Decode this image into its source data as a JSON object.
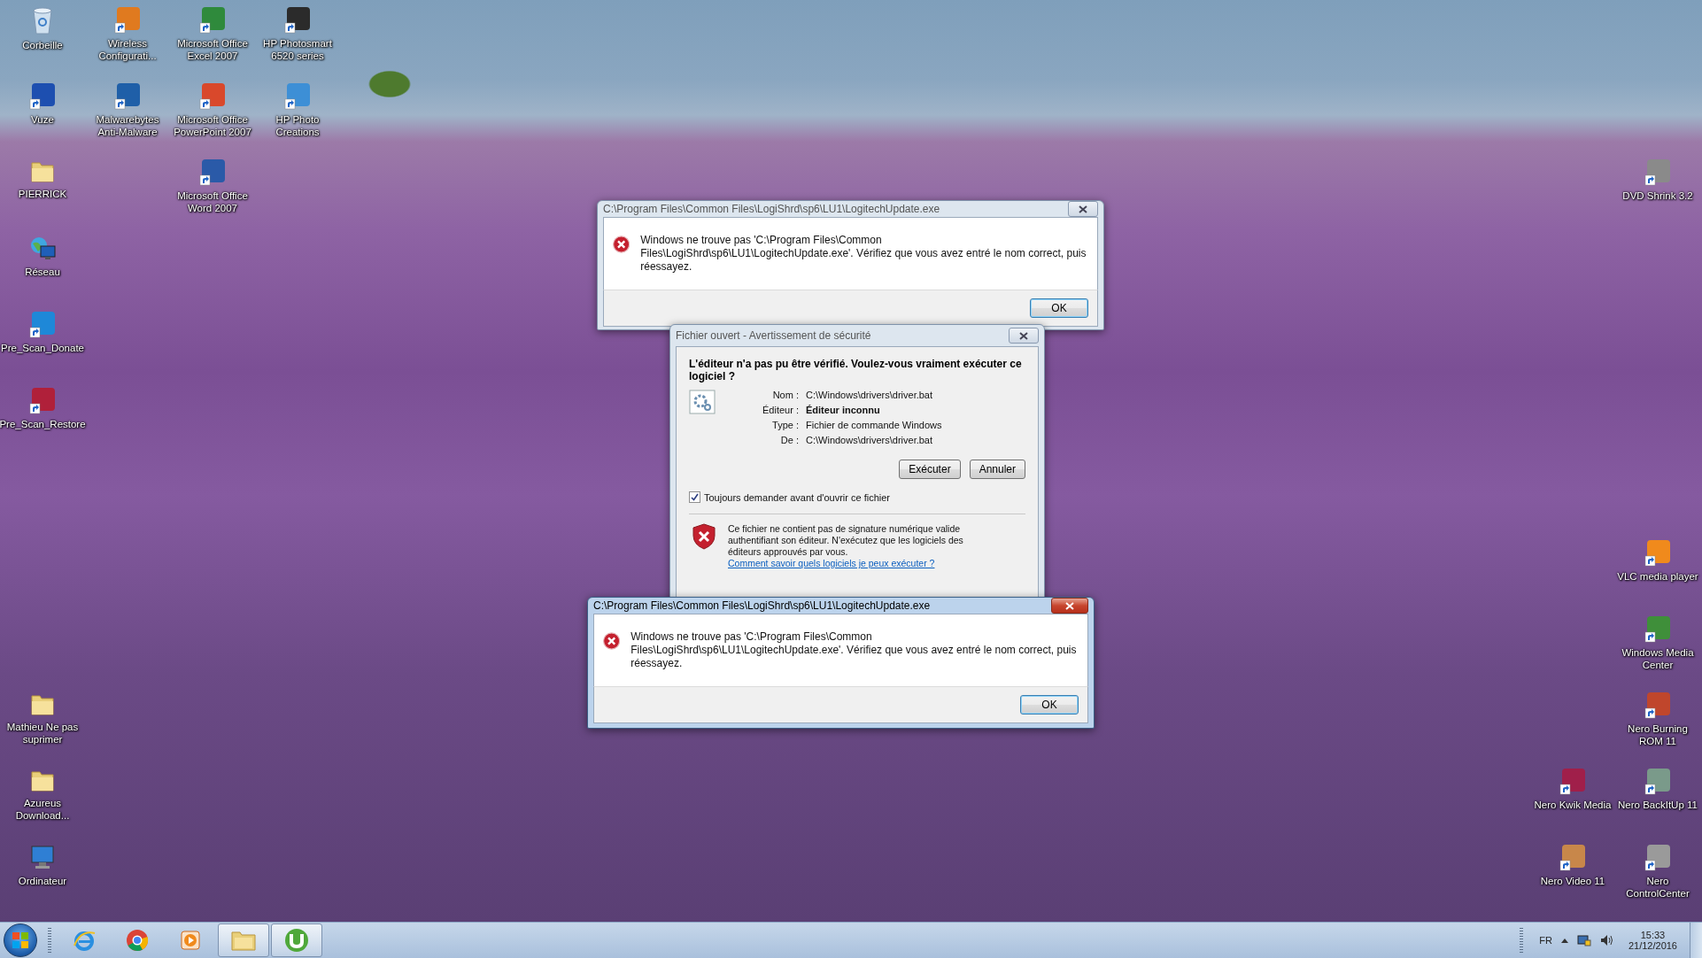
{
  "desktop_icons": [
    {
      "kind": "bin",
      "label": "Corbeille"
    },
    {
      "kind": "shortcut",
      "label": "Wireless Configurati...",
      "color": "#e07a1f"
    },
    {
      "kind": "shortcut",
      "label": "Microsoft Office Excel 2007",
      "color": "#2f8a3c"
    },
    {
      "kind": "shortcut",
      "label": "HP Photosmart 6520 series",
      "color": "#2b2b2b"
    },
    {
      "kind": "shortcut",
      "label": "Vuze",
      "color": "#1d4fb0"
    },
    {
      "kind": "shortcut",
      "label": "Malwarebytes Anti-Malware",
      "color": "#1f5fa8"
    },
    {
      "kind": "shortcut",
      "label": "Microsoft Office PowerPoint 2007",
      "color": "#d9482b"
    },
    {
      "kind": "shortcut",
      "label": "HP Photo Creations",
      "color": "#3d8fd6"
    },
    {
      "kind": "folder",
      "label": "PIERRICK"
    },
    {
      "kind": "shortcut",
      "label": "Microsoft Office Word 2007",
      "color": "#2a5aa8"
    },
    {
      "kind": "network",
      "label": "Réseau"
    },
    {
      "kind": "shortcut",
      "label": "Pre_Scan_Donate",
      "color": "#1e88d8"
    },
    {
      "kind": "shortcut",
      "label": "Pre_Scan_Restore",
      "color": "#b0203a"
    },
    {
      "kind": "folder",
      "label": "Mathieu Ne pas suprimer"
    },
    {
      "kind": "folder",
      "label": "Azureus Download..."
    },
    {
      "kind": "computer",
      "label": "Ordinateur"
    },
    {
      "kind": "shortcut",
      "label": "DVD Shrink 3.2",
      "color": "#8a8a8a"
    },
    {
      "kind": "shortcut",
      "label": "VLC media player",
      "color": "#f08a1c"
    },
    {
      "kind": "shortcut",
      "label": "Windows Media Center",
      "color": "#3f8f3a"
    },
    {
      "kind": "shortcut",
      "label": "Nero Burning ROM 11",
      "color": "#c0462c"
    },
    {
      "kind": "shortcut",
      "label": "Nero Kwik Media",
      "color": "#a01f4a"
    },
    {
      "kind": "shortcut",
      "label": "Nero BackItUp 11",
      "color": "#7a9a8a"
    },
    {
      "kind": "shortcut",
      "label": "Nero Video 11",
      "color": "#c8874a"
    },
    {
      "kind": "shortcut",
      "label": "Nero ControlCenter",
      "color": "#9a9a9a"
    }
  ],
  "windows": [
    {
      "kind": "error",
      "active": false,
      "title": "C:\\Program Files\\Common Files\\LogiShrd\\sp6\\LU1\\LogitechUpdate.exe",
      "message": "Windows ne trouve pas 'C:\\Program Files\\Common Files\\LogiShrd\\sp6\\LU1\\LogitechUpdate.exe'. Vérifiez que vous avez entré le nom correct, puis réessayez.",
      "ok": "OK"
    },
    {
      "kind": "security",
      "active": false,
      "title": "Fichier ouvert - Avertissement de sécurité",
      "heading": "L'éditeur n'a pas pu être vérifié. Voulez-vous vraiment exécuter ce logiciel ?",
      "fields": [
        {
          "label": "Nom :",
          "value": "C:\\Windows\\drivers\\driver.bat",
          "bold": false
        },
        {
          "label": "Éditeur :",
          "value": "Éditeur inconnu",
          "bold": true
        },
        {
          "label": "Type :",
          "value": "Fichier de commande Windows",
          "bold": false
        },
        {
          "label": "De :",
          "value": "C:\\Windows\\drivers\\driver.bat",
          "bold": false
        }
      ],
      "buttons": [
        "Exécuter",
        "Annuler"
      ],
      "checkbox": {
        "label": "Toujours demander avant d'ouvrir ce fichier",
        "checked": true
      },
      "footer": {
        "text": "Ce fichier ne contient pas de signature numérique valide authentifiant son éditeur. N'exécutez que les logiciels des éditeurs approuvés par vous.",
        "link": "Comment savoir quels logiciels je peux exécuter ?"
      }
    },
    {
      "kind": "error",
      "active": true,
      "title": "C:\\Program Files\\Common Files\\LogiShrd\\sp6\\LU1\\LogitechUpdate.exe",
      "message": "Windows ne trouve pas 'C:\\Program Files\\Common Files\\LogiShrd\\sp6\\LU1\\LogitechUpdate.exe'. Vérifiez que vous avez entré le nom correct, puis réessayez.",
      "ok": "OK"
    }
  ],
  "taskbar": {
    "items": [
      {
        "kind": "ie",
        "running": false
      },
      {
        "kind": "chrome",
        "running": false
      },
      {
        "kind": "media",
        "running": false
      },
      {
        "kind": "explorer",
        "running": true
      },
      {
        "kind": "utorrent",
        "running": true
      }
    ],
    "language": "FR",
    "time": "15:33",
    "date": "21/12/2016"
  }
}
